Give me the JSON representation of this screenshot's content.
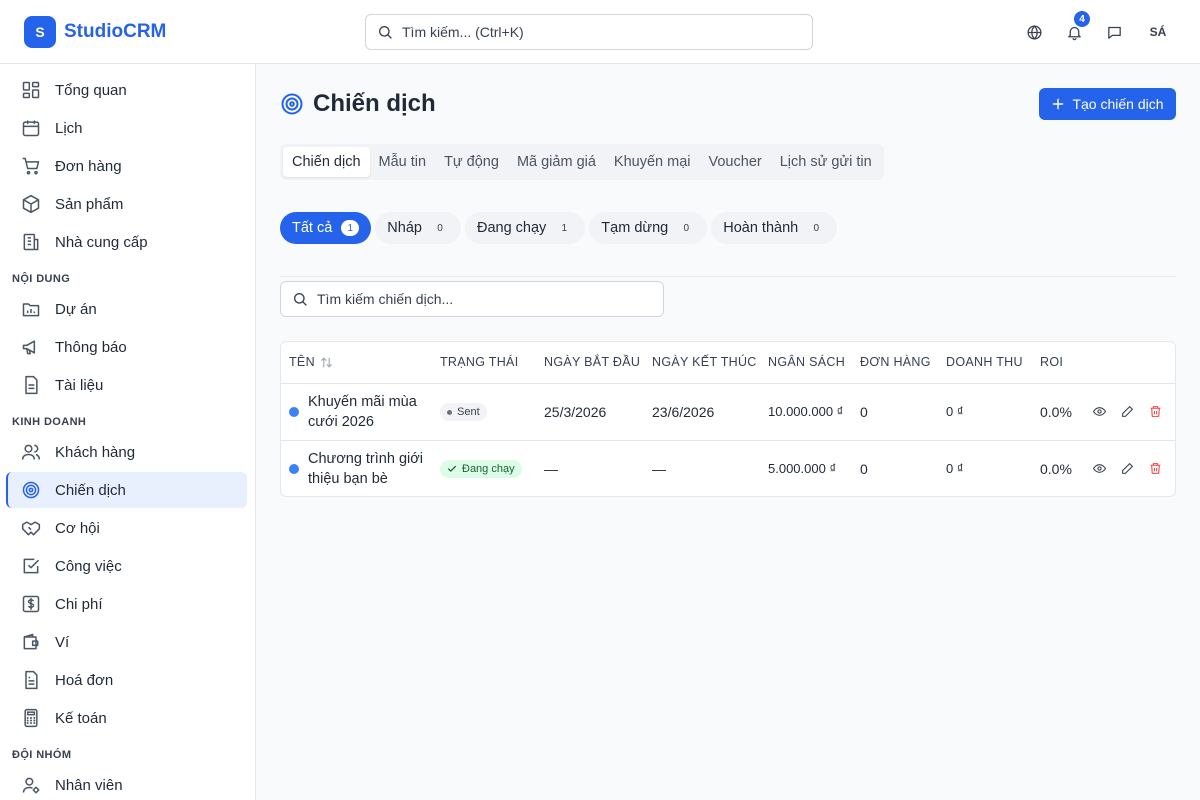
{
  "app": {
    "logo_letter": "S",
    "name": "StudioCRM"
  },
  "header": {
    "search_placeholder": "Tìm kiếm... (Ctrl+K)",
    "notification_count": "4",
    "avatar_initials": "SÁ"
  },
  "sidebar": {
    "group_main": [
      {
        "label": "Tổng quan",
        "icon": "dashboard-icon"
      },
      {
        "label": "Lịch",
        "icon": "calendar-icon"
      },
      {
        "label": "Đơn hàng",
        "icon": "cart-icon"
      },
      {
        "label": "Sản phẩm",
        "icon": "box-icon"
      },
      {
        "label": "Nhà cung cấp",
        "icon": "building-icon"
      }
    ],
    "section_content": "NỘI DUNG",
    "group_content": [
      {
        "label": "Dự án",
        "icon": "folder-chart-icon"
      },
      {
        "label": "Thông báo",
        "icon": "megaphone-icon"
      },
      {
        "label": "Tài liệu",
        "icon": "document-icon"
      }
    ],
    "section_business": "KINH DOANH",
    "group_business": [
      {
        "label": "Khách hàng",
        "icon": "users-icon"
      },
      {
        "label": "Chiến dịch",
        "icon": "target-icon",
        "active": true
      },
      {
        "label": "Cơ hội",
        "icon": "handshake-icon"
      },
      {
        "label": "Công việc",
        "icon": "checkbox-icon"
      },
      {
        "label": "Chi phí",
        "icon": "dollar-icon"
      },
      {
        "label": "Ví",
        "icon": "wallet-icon"
      },
      {
        "label": "Hoá đơn",
        "icon": "invoice-icon"
      },
      {
        "label": "Kế toán",
        "icon": "calculator-icon"
      }
    ],
    "section_team": "ĐỘI NHÓM",
    "group_team": [
      {
        "label": "Nhân viên",
        "icon": "user-gear-icon"
      }
    ]
  },
  "main": {
    "title": "Chiến dịch",
    "create_button": "Tạo chiến dịch",
    "tabs": [
      "Chiến dịch",
      "Mẫu tin",
      "Tự động",
      "Mã giảm giá",
      "Khuyến mại",
      "Voucher",
      "Lịch sử gửi tin"
    ],
    "filters": [
      {
        "label": "Tất cả",
        "count": "1"
      },
      {
        "label": "Nháp",
        "count": "0"
      },
      {
        "label": "Đang chạy",
        "count": "1"
      },
      {
        "label": "Tạm dừng",
        "count": "0"
      },
      {
        "label": "Hoàn thành",
        "count": "0"
      }
    ],
    "search_placeholder": "Tìm kiếm chiến dịch..."
  },
  "table": {
    "columns": [
      "TÊN",
      "TRẠNG THÁI",
      "NGÀY BẮT ĐẦU",
      "NGÀY KẾT THÚC",
      "NGÂN SÁCH",
      "ĐƠN HÀNG",
      "DOANH THU",
      "ROI"
    ],
    "rows": [
      {
        "name": "Khuyến mãi mùa cưới 2026",
        "status": "Sent",
        "start": "25/3/2026",
        "end": "23/6/2026",
        "budget": "10.000.000 ₫",
        "orders": "0",
        "revenue": "0 ₫",
        "roi": "0.0%"
      },
      {
        "name": "Chương trình giới thiệu bạn bè",
        "status": "Đang chạy",
        "start": "—",
        "end": "—",
        "budget": "5.000.000 ₫",
        "orders": "0",
        "revenue": "0 ₫",
        "roi": "0.0%"
      }
    ]
  },
  "colors": {
    "accent": "#2563eb",
    "running_bg": "#dcfce7",
    "delete": "#ef4444"
  }
}
